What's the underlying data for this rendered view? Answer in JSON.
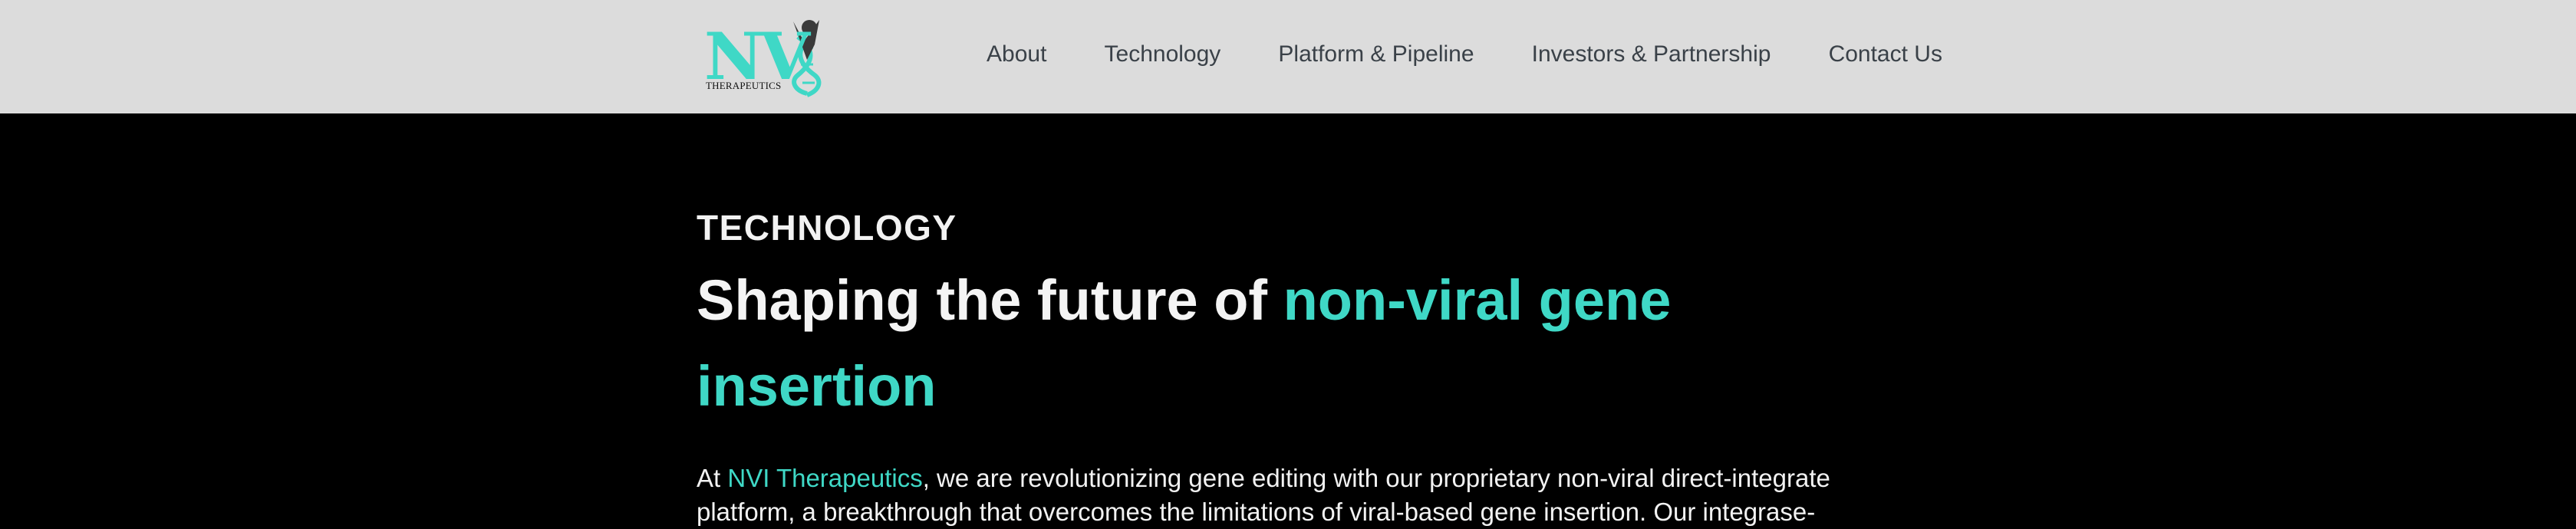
{
  "header": {
    "logo": {
      "letters": "NV",
      "subtitle": "THERAPEUTICS",
      "icon": "dna-person-icon",
      "accent_color": "#3fd8c6"
    },
    "nav": [
      {
        "label": "About"
      },
      {
        "label": "Technology"
      },
      {
        "label": "Platform & Pipeline"
      },
      {
        "label": "Investors & Partnership"
      },
      {
        "label": "Contact Us"
      }
    ]
  },
  "hero": {
    "eyebrow": "TECHNOLOGY",
    "headline_prefix": "Shaping the future of ",
    "headline_accent": "non-viral gene insertion",
    "paragraph": {
      "prefix": "At ",
      "link": "NVI Therapeutics",
      "text": ", we are revolutionizing gene editing with our proprietary non-viral direct-integrate platform, a breakthrough that overcomes the limitations of viral-based gene insertion. Our integrase-"
    }
  },
  "colors": {
    "header_bg": "#dcdcdc",
    "page_bg": "#000000",
    "accent": "#3fd8c6",
    "nav_text": "#3a4148"
  }
}
